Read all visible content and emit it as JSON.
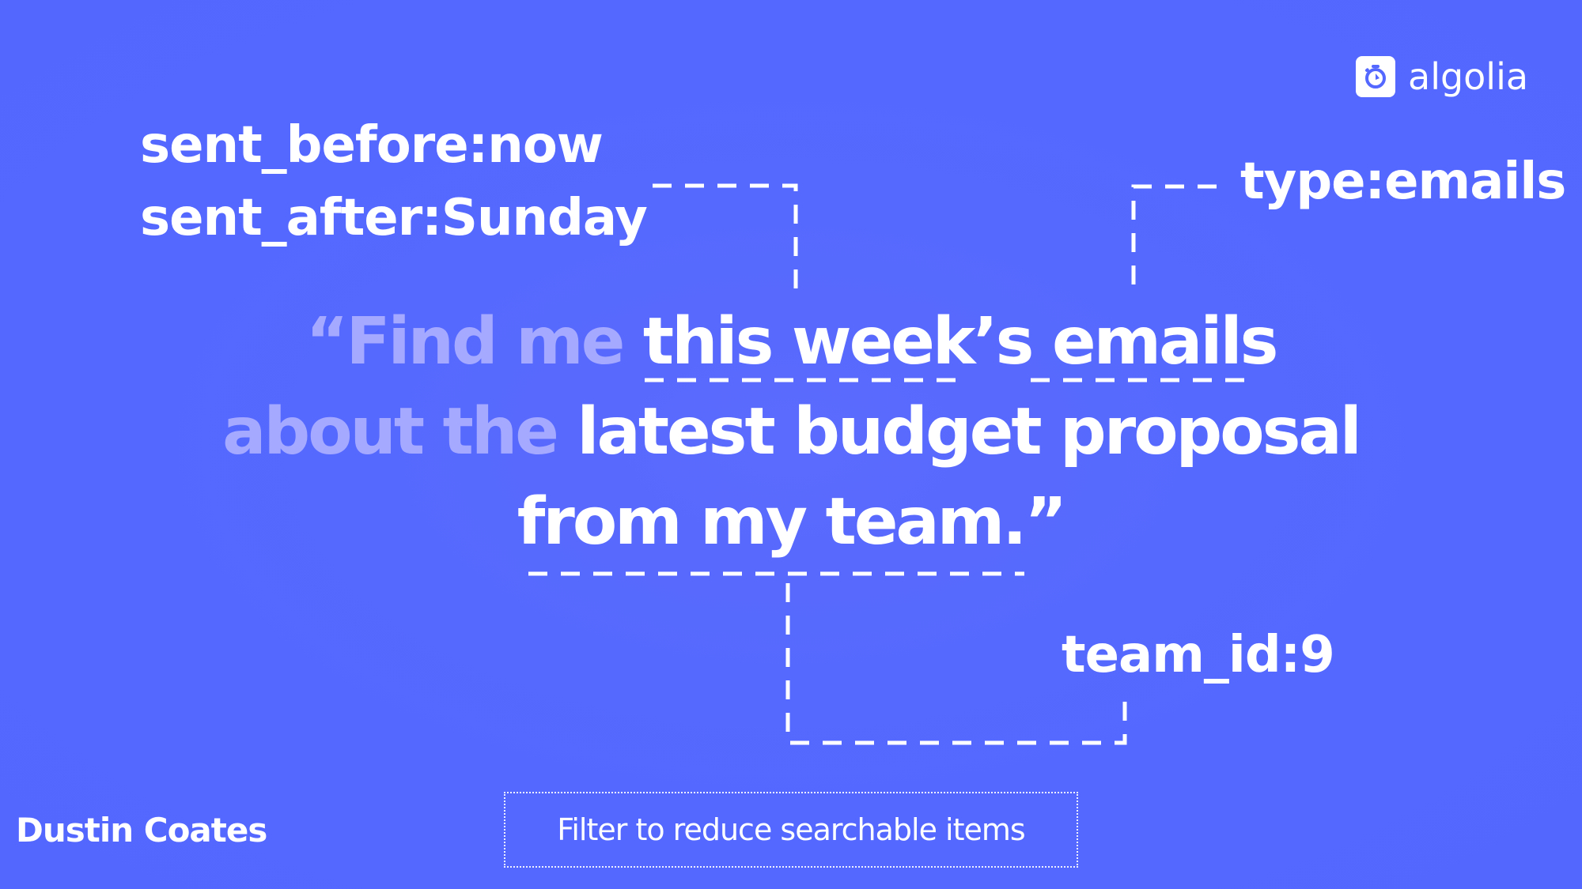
{
  "brand": {
    "logo_icon": "stopwatch-icon",
    "name": "algolia",
    "accent_color": "#5468ff"
  },
  "filters": {
    "sent_before": "sent_before:now",
    "sent_after": "sent_after:Sunday",
    "type": "type:emails",
    "team": "team_id:9"
  },
  "quote": {
    "line1": {
      "open_quote": "“",
      "dim": "Find me",
      "bright_a": "this week’s",
      "bright_b": "emails"
    },
    "line2": {
      "dim": "about the",
      "bright": "latest budget proposal"
    },
    "line3": {
      "bright": "from my team.",
      "close_quote": "”"
    },
    "dim_color": "#a5a9ff"
  },
  "footer": {
    "author": "Dustin Coates",
    "caption": "Filter to reduce searchable items"
  }
}
